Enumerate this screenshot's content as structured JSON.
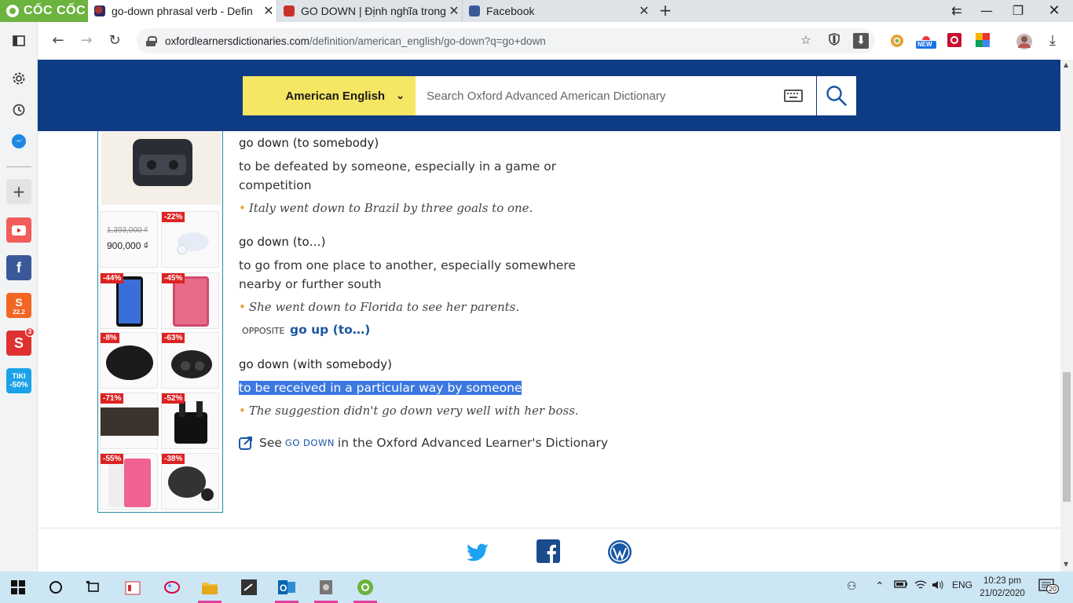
{
  "browser": {
    "brand": "CỐC CỐC",
    "tabs": [
      {
        "title": "go-down phrasal verb - Defin",
        "active": true
      },
      {
        "title": "GO DOWN | Định nghĩa trong",
        "active": false
      },
      {
        "title": "Facebook",
        "active": false
      }
    ],
    "url_host": "oxfordlearnersdictionaries.com",
    "url_path": "/definition/american_english/go-down?q=go+down",
    "ext_badge_new": "NEW"
  },
  "sidebar": {
    "tiki_label": "TIKI",
    "tiki_discount": "-50%",
    "notif_count": "3",
    "shopee_label": "22.2"
  },
  "header": {
    "dictionary_label": "American English",
    "search_placeholder": "Search Oxford Advanced American Dictionary"
  },
  "ad": {
    "price_old": "1,393,000 ₫",
    "price_new": "900,000 ₫",
    "discounts": [
      "-22%",
      "-44%",
      "-45%",
      "-8%",
      "-63%",
      "-71%",
      "-52%",
      "-55%",
      "-38%"
    ]
  },
  "entry": {
    "senses": [
      {
        "head": "go down (to somebody)",
        "def": "to be defeated by someone, especially in a game or competition",
        "example": "Italy went down to Brazil by three goals to one."
      },
      {
        "head": "go down (to…)",
        "def": "to go from one place to another, especially somewhere nearby or further south",
        "example": "She went down to Florida to see her parents.",
        "opposite_label": "OPPOSITE",
        "opposite_link": "go up (to…)"
      },
      {
        "head": "go down (with somebody)",
        "def": "to be received in a particular way by someone",
        "example": "The suggestion didn't go down very well with her boss."
      }
    ],
    "see_also_prefix": "See",
    "see_also_link": "go down",
    "see_also_suffix": "in the Oxford Advanced Learner's Dictionary"
  },
  "taskbar": {
    "language": "ENG",
    "time": "10:23 pm",
    "date": "21/02/2020",
    "notification_count": "20"
  },
  "colors": {
    "header_blue": "#0d3b84",
    "selector_yellow": "#f5e663",
    "link_blue": "#1a57a5",
    "highlight": "#3b78e0",
    "bullet_orange": "#e8a23a",
    "badge_red": "#d22222",
    "taskbar": "#cde6f4"
  }
}
